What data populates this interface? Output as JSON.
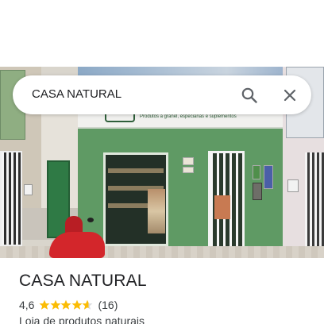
{
  "search": {
    "query": "CASA NATURAL",
    "search_icon": "search-icon",
    "close_icon": "close-icon"
  },
  "photo": {
    "storefront_tagline": "Produtos a granel, especiarias e suplementos"
  },
  "place": {
    "name": "CASA NATURAL",
    "rating": "4,6",
    "rating_value": 4.6,
    "stars_max": 5,
    "review_count": "(16)",
    "category": "Loja de produtos naturais"
  },
  "colors": {
    "star": "#fbbc04",
    "star_empty": "#dadce0",
    "text_primary": "#202124",
    "text_secondary": "#3c4043",
    "icon": "#5f6368"
  }
}
